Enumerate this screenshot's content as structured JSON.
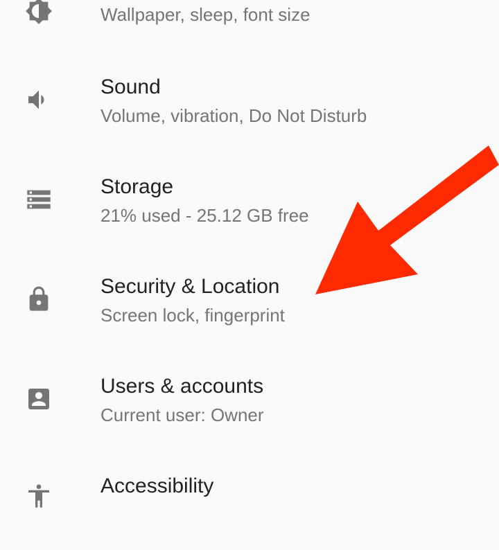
{
  "settings": {
    "items": [
      {
        "icon": "display-icon",
        "title": "",
        "subtitle": "Wallpaper, sleep, font size"
      },
      {
        "icon": "volume-icon",
        "title": "Sound",
        "subtitle": "Volume, vibration, Do Not Disturb"
      },
      {
        "icon": "storage-icon",
        "title": "Storage",
        "subtitle": "21% used - 25.12 GB free"
      },
      {
        "icon": "lock-icon",
        "title": "Security & Location",
        "subtitle": "Screen lock, fingerprint"
      },
      {
        "icon": "account-box-icon",
        "title": "Users & accounts",
        "subtitle": "Current user: Owner"
      },
      {
        "icon": "accessibility-icon",
        "title": "Accessibility",
        "subtitle": ""
      }
    ]
  },
  "colors": {
    "background": "#fafafa",
    "title": "#212121",
    "subtitle": "#757575",
    "icon": "#757575",
    "arrow": "#ff2a00"
  },
  "annotation": {
    "icon": "red-arrow-icon",
    "points_to": "Security & Location"
  }
}
